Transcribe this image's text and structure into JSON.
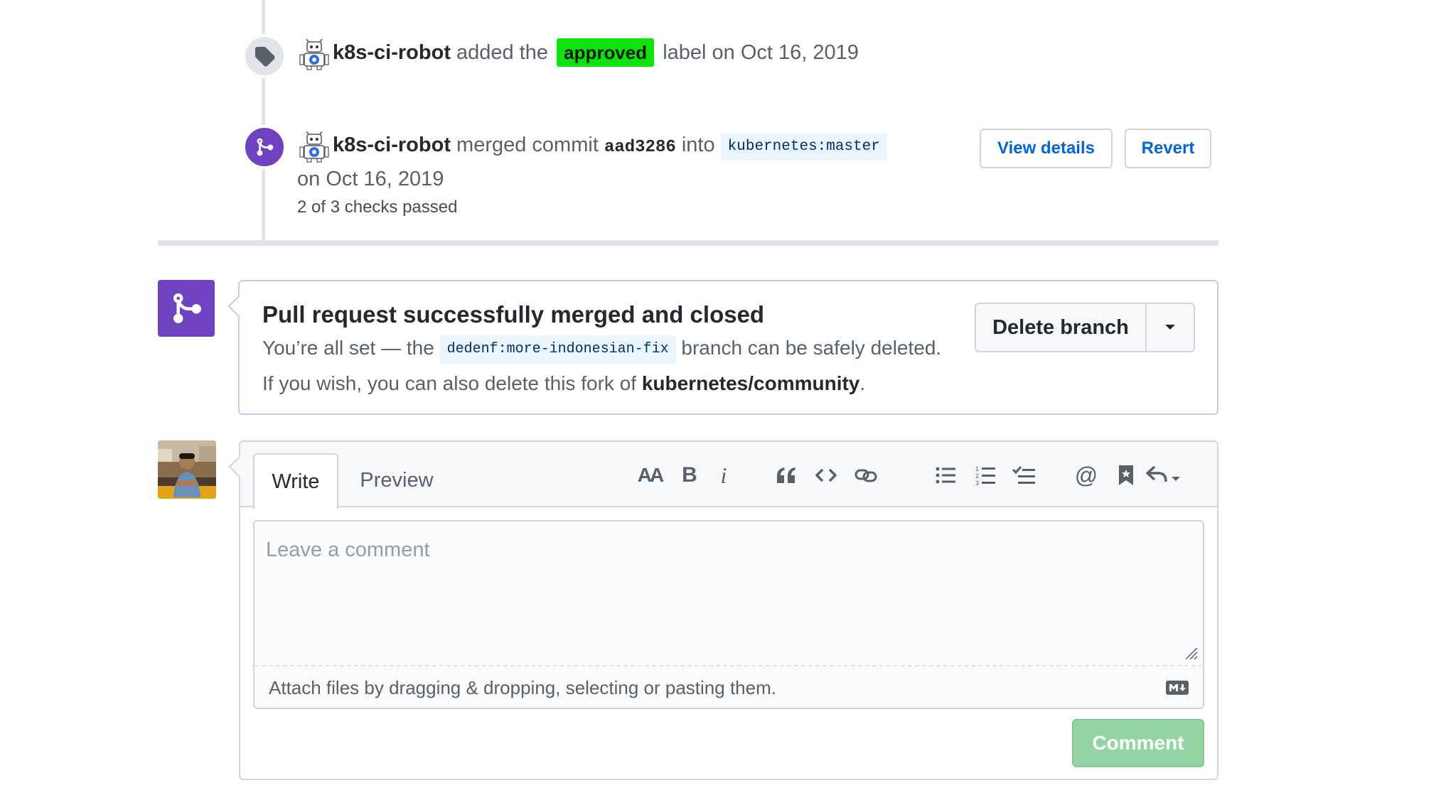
{
  "timeline": {
    "label_event": {
      "actor": "k8s-ci-robot",
      "text_before": "added the",
      "label": "approved",
      "label_color": "#0ee30e",
      "text_after": "label on Oct 16, 2019"
    },
    "merge_event": {
      "actor": "k8s-ci-robot",
      "text_merged": "merged commit",
      "sha": "aad3286",
      "text_into": "into",
      "target": "kubernetes:master",
      "date": "on Oct 16, 2019",
      "checks": "2 of 3 checks passed",
      "view_details": "View details",
      "revert": "Revert"
    }
  },
  "merged_box": {
    "title": "Pull request successfully merged and closed",
    "line1_before": "You’re all set — the",
    "branch": "dedenf:more-indonesian-fix",
    "line1_after": "branch can be safely deleted.",
    "line2_before": "If you wish, you can also delete this fork of",
    "fork": "kubernetes/community",
    "line2_after": ".",
    "delete_button": "Delete branch",
    "accent_color": "#6f42c1"
  },
  "comment_form": {
    "tabs": [
      "Write",
      "Preview"
    ],
    "placeholder": "Leave a comment",
    "attach_text": "Attach files by dragging & dropping, selecting or pasting them.",
    "toolbar_icons": [
      "text-size-icon",
      "bold-icon",
      "italic-icon",
      "quote-icon",
      "code-icon",
      "link-icon",
      "unordered-list-icon",
      "ordered-list-icon",
      "task-list-icon",
      "mention-icon",
      "saved-reply-icon",
      "reply-icon"
    ],
    "toolbar": {
      "heading": "AA",
      "bold": "B",
      "italic": "i",
      "mention": "@"
    },
    "submit": "Comment",
    "submit_color": "#94d3a2"
  }
}
